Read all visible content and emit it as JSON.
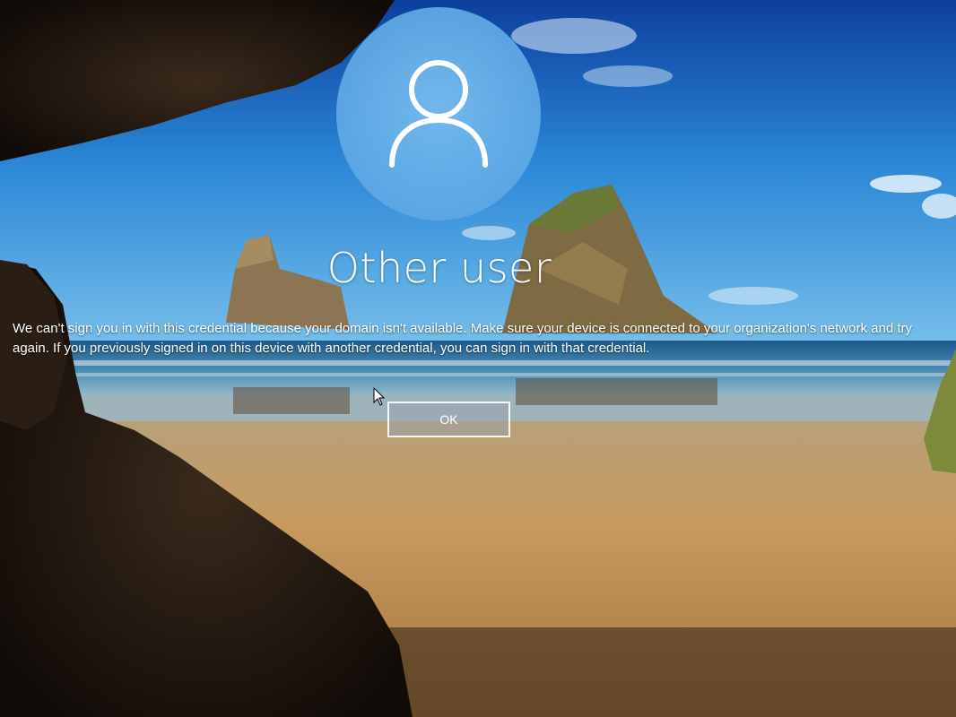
{
  "login": {
    "username": "Other user",
    "message": "We can't sign you in with this credential because your domain isn't available. Make sure your device is connected to your organization's network and try again. If you previously signed in on this device with another credential, you can sign in with that credential.",
    "ok_label": "OK"
  },
  "icons": {
    "avatar": "user-silhouette-icon",
    "cursor": "mouse-pointer-icon"
  },
  "colors": {
    "avatar_circle": "#6fb6ec",
    "text": "#ffffff",
    "sky": "#1f6fc8"
  }
}
